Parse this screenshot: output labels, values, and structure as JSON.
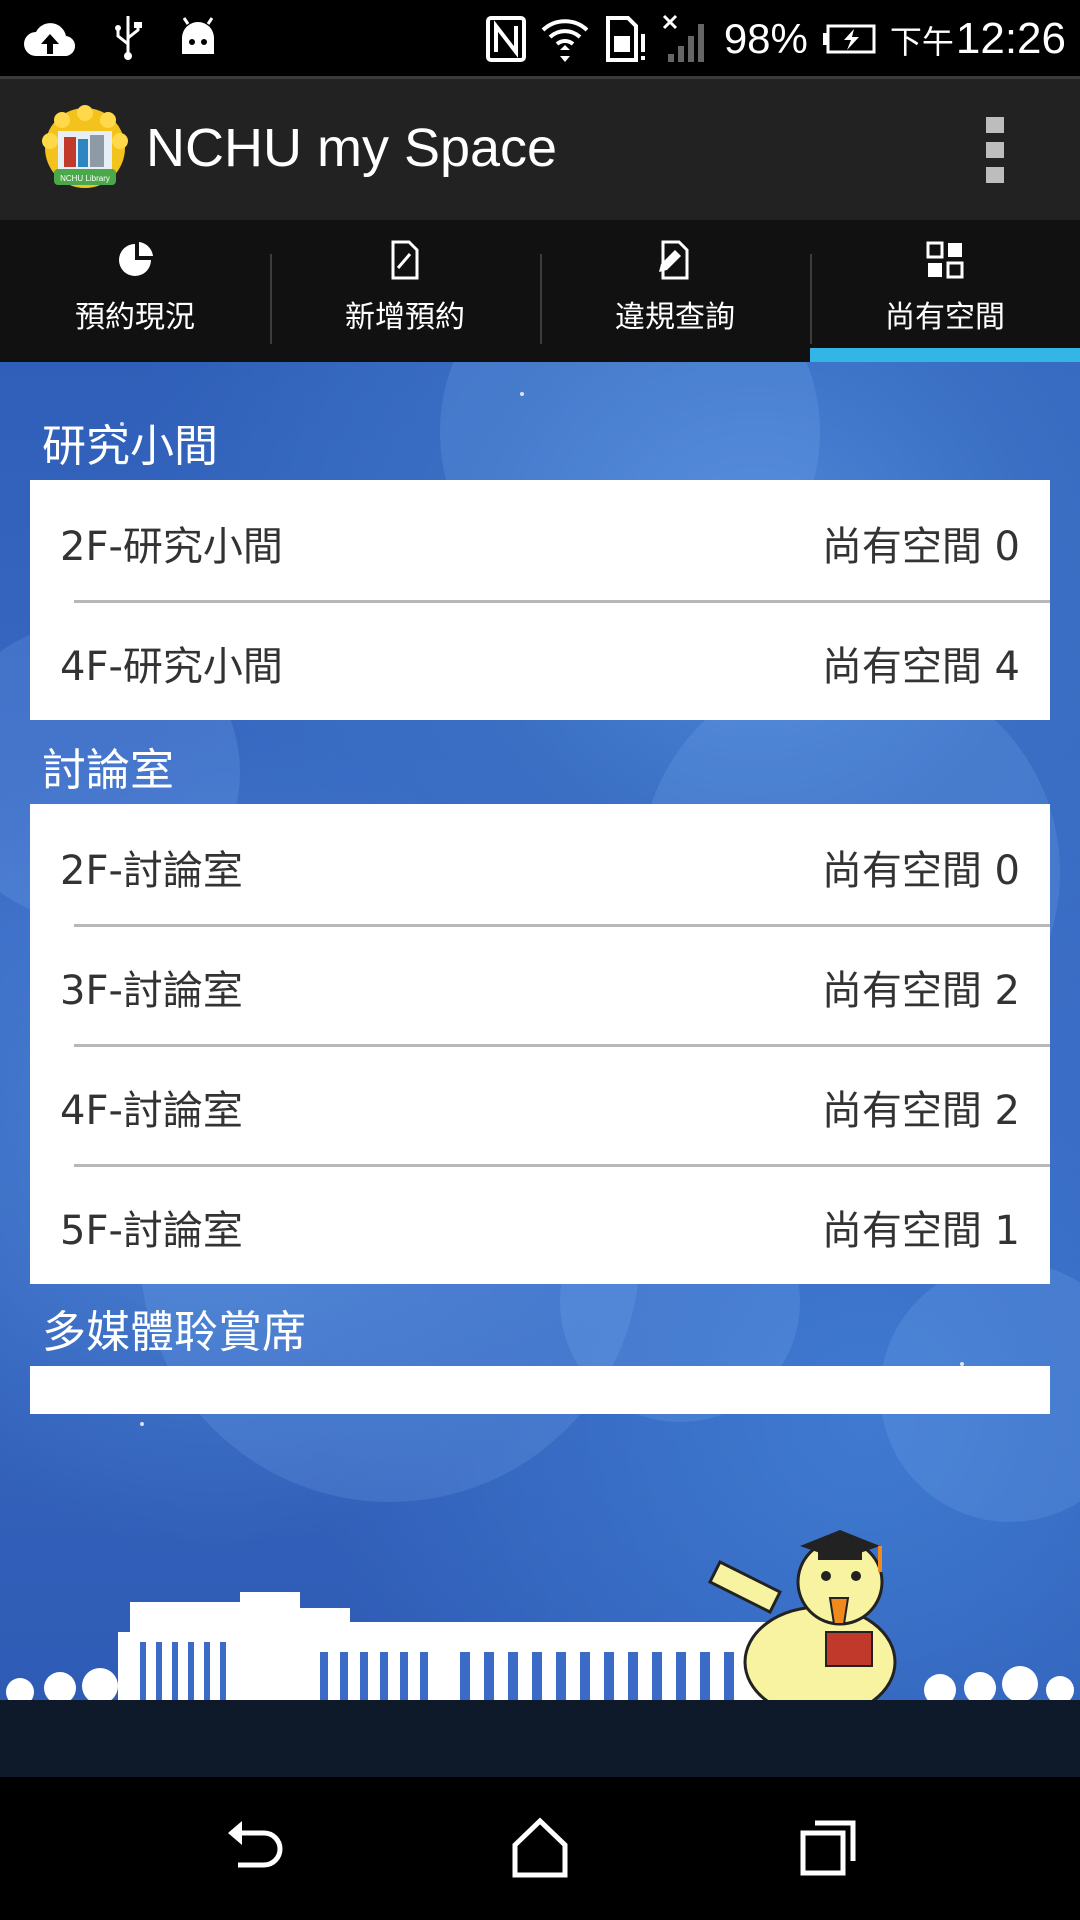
{
  "status_bar": {
    "battery_percent": "98%",
    "time_prefix": "下午",
    "time": "12:26",
    "icons": [
      "cloud-upload-icon",
      "usb-icon",
      "android-icon",
      "nfc-icon",
      "wifi-icon",
      "sim-alert-icon",
      "no-signal-icon",
      "battery-charging-icon"
    ]
  },
  "app_bar": {
    "logo_text": "NCHU Library",
    "title": "NCHU my Space",
    "overflow_icon": "more-vert-icon"
  },
  "tabs": [
    {
      "label": "預約現況",
      "icon": "pie-chart-icon",
      "active": false
    },
    {
      "label": "新增預約",
      "icon": "new-document-icon",
      "active": false
    },
    {
      "label": "違規查詢",
      "icon": "edit-document-icon",
      "active": false
    },
    {
      "label": "尚有空間",
      "icon": "grid-icon",
      "active": true
    }
  ],
  "sections": [
    {
      "title": "研究小間",
      "rows": [
        {
          "name": "2F-研究小間",
          "avail": "尚有空間 0"
        },
        {
          "name": "4F-研究小間",
          "avail": "尚有空間 4"
        }
      ]
    },
    {
      "title": "討論室",
      "rows": [
        {
          "name": "2F-討論室",
          "avail": "尚有空間 0"
        },
        {
          "name": "3F-討論室",
          "avail": "尚有空間 2"
        },
        {
          "name": "4F-討論室",
          "avail": "尚有空間 2"
        },
        {
          "name": "5F-討論室",
          "avail": "尚有空間 1"
        }
      ]
    },
    {
      "title": "多媒體聆賞席",
      "rows": []
    }
  ],
  "nav_bar": {
    "buttons": [
      "back-icon",
      "home-icon",
      "recents-icon"
    ]
  },
  "colors": {
    "accent": "#33b5e5",
    "background": "#3a6cc6",
    "card": "#ffffff"
  }
}
